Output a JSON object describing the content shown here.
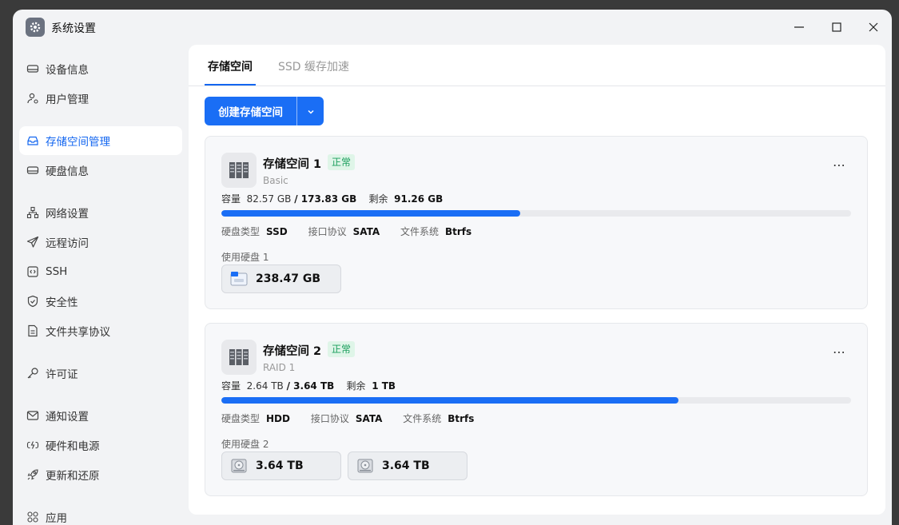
{
  "window": {
    "title": "系统设置"
  },
  "sidebar": {
    "items": [
      {
        "label": "设备信息",
        "icon": "device-icon"
      },
      {
        "label": "用户管理",
        "icon": "user-icon"
      },
      {
        "label": "存储空间管理",
        "icon": "storage-icon",
        "active": true
      },
      {
        "label": "硬盘信息",
        "icon": "disk-icon"
      },
      {
        "label": "网络设置",
        "icon": "network-icon"
      },
      {
        "label": "远程访问",
        "icon": "send-icon"
      },
      {
        "label": "SSH",
        "icon": "code-icon"
      },
      {
        "label": "安全性",
        "icon": "shield-icon"
      },
      {
        "label": "文件共享协议",
        "icon": "document-icon"
      },
      {
        "label": "许可证",
        "icon": "key-icon"
      },
      {
        "label": "通知设置",
        "icon": "mail-icon"
      },
      {
        "label": "硬件和电源",
        "icon": "power-icon"
      },
      {
        "label": "更新和还原",
        "icon": "rocket-icon"
      },
      {
        "label": "应用",
        "icon": "apps-icon"
      }
    ]
  },
  "tabs": [
    {
      "label": "存储空间",
      "active": true
    },
    {
      "label": "SSD 缓存加速",
      "active": false
    }
  ],
  "toolbar": {
    "create_label": "创建存储空间"
  },
  "pools": [
    {
      "name": "存储空间 1",
      "status": "正常",
      "type": "Basic",
      "cap_label": "容量",
      "used": "82.57 GB",
      "total": "173.83 GB",
      "free_label": "剩余",
      "free": "91.26 GB",
      "usage_fraction": 0.475,
      "disk_type_label": "硬盘类型",
      "disk_type": "SSD",
      "iface_label": "接口协议",
      "iface": "SATA",
      "fs_label": "文件系统",
      "fs": "Btrfs",
      "disks_label": "使用硬盘 1",
      "disks": [
        {
          "size": "238.47 GB",
          "kind": "ssd"
        }
      ]
    },
    {
      "name": "存储空间 2",
      "status": "正常",
      "type": "RAID 1",
      "cap_label": "容量",
      "used": "2.64 TB",
      "total": "3.64 TB",
      "free_label": "剩余",
      "free": "1 TB",
      "usage_fraction": 0.726,
      "disk_type_label": "硬盘类型",
      "disk_type": "HDD",
      "iface_label": "接口协议",
      "iface": "SATA",
      "fs_label": "文件系统",
      "fs": "Btrfs",
      "disks_label": "使用硬盘 2",
      "disks": [
        {
          "size": "3.64 TB",
          "kind": "hdd"
        },
        {
          "size": "3.64 TB",
          "kind": "hdd"
        }
      ]
    }
  ],
  "colors": {
    "accent": "#1a6ef5",
    "status_green": "#1a9e5c",
    "status_bg": "#dff5e8"
  }
}
